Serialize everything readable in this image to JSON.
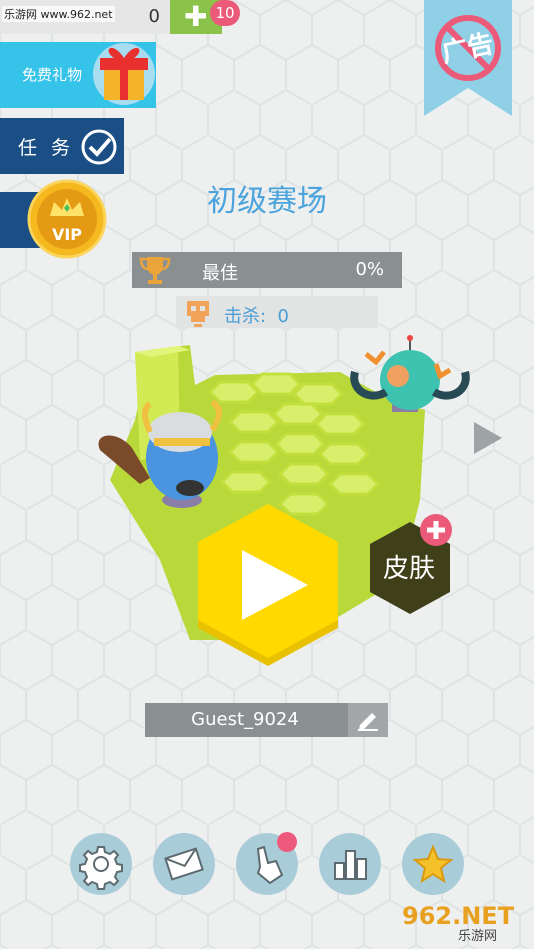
{
  "watermark_top": "乐游网 www.962.net",
  "top_bar": {
    "coins": "0",
    "plus_badge": "10"
  },
  "side": {
    "gift_label": "免费礼物",
    "task_label": "任务",
    "vip_label": "VIP"
  },
  "noads_label": "广告",
  "title": "初级赛场",
  "stats": {
    "best_label": "最佳",
    "best_value": "0%",
    "kills_label": "击杀:",
    "kills_value": "0"
  },
  "skin_label": "皮肤",
  "player": {
    "name": "Guest_9024"
  },
  "bottom_nav": [
    "settings-icon",
    "mail-icon",
    "tap-icon",
    "leaderboard-icon",
    "star-icon"
  ],
  "watermark_bottom": {
    "brand": "962.NET",
    "sub": "乐游网"
  },
  "colors": {
    "accent_blue": "#35c3ea",
    "dark_blue": "#1a4e84",
    "play_yellow": "#ffd900",
    "grass": "#c5e34a",
    "skin_hex": "#3f3f19",
    "badge_pink": "#ec5a7a"
  }
}
